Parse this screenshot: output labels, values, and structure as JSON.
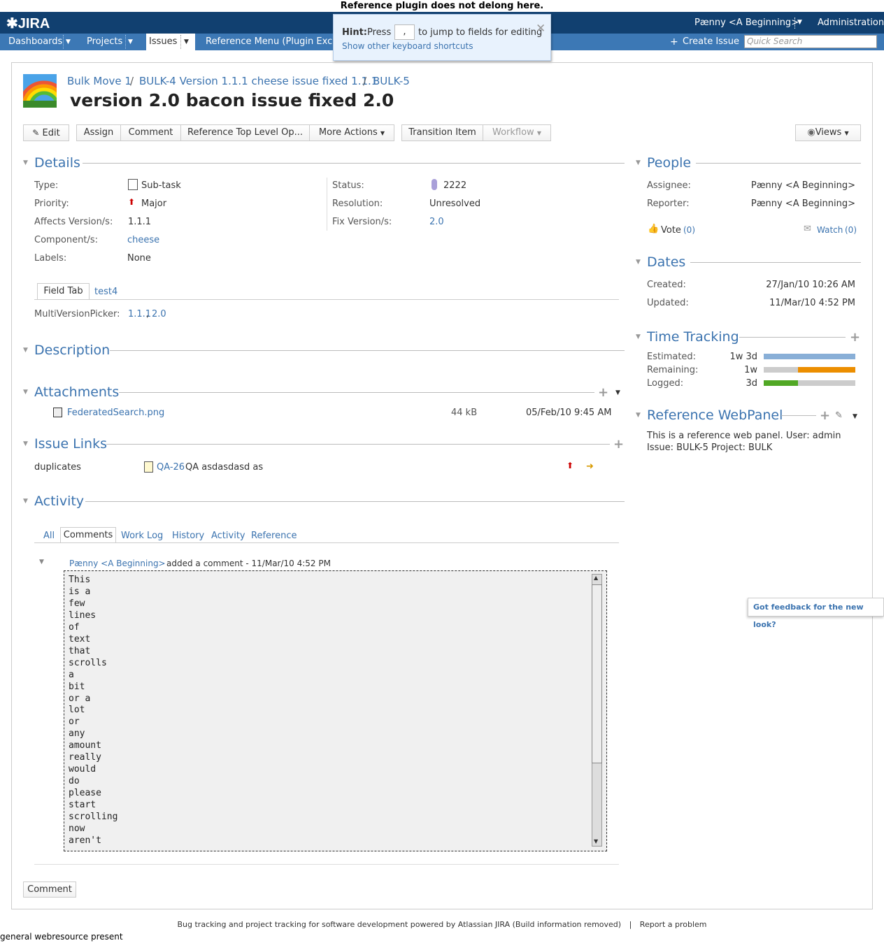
{
  "banner": "Reference plugin does not delong here.",
  "header": {
    "logo": "JIRA",
    "user": "Pænny <A Beginning>",
    "admin": "Administration"
  },
  "nav": {
    "dashboards": "Dashboards",
    "projects": "Projects",
    "issues": "Issues",
    "reference_menu": "Reference Menu (Plugin Excha",
    "create_issue": "Create Issue",
    "search_placeholder": "Quick Search"
  },
  "hint": {
    "label": "Hint:",
    "press": "Press",
    "key": ",",
    "after": "to jump to fields for editing",
    "link": "Show other keyboard shortcuts"
  },
  "breadcrumb": {
    "project": "Bulk Move 1",
    "parent": "BULK-4 Version 1.1.1 cheese issue fixed 1.1.1",
    "key": "BULK-5",
    "sep": "/"
  },
  "issue": {
    "summary": "version 2.0 bacon issue fixed 2.0"
  },
  "toolbar": {
    "edit": "Edit",
    "assign": "Assign",
    "comment": "Comment",
    "ref_op": "Reference Top Level Op...",
    "more_actions": "More Actions",
    "transition": "Transition Item",
    "workflow": "Workflow",
    "views": "Views"
  },
  "details": {
    "title": "Details",
    "type_label": "Type:",
    "type": "Sub-task",
    "priority_label": "Priority:",
    "priority": "Major",
    "affects_label": "Affects Version/s:",
    "affects": "1.1.1",
    "component_label": "Component/s:",
    "component": "cheese",
    "labels_label": "Labels:",
    "labels": "None",
    "status_label": "Status:",
    "status": "2222",
    "resolution_label": "Resolution:",
    "resolution": "Unresolved",
    "fix_label": "Fix Version/s:",
    "fix": "2.0",
    "tab_field": "Field Tab",
    "tab_test4": "test4",
    "mvp_label": "MultiVersionPicker:",
    "mvp_v1": "1.1.1",
    "mvp_comma": ",",
    "mvp_v2": "2.0"
  },
  "description": {
    "title": "Description"
  },
  "attachments": {
    "title": "Attachments",
    "file": "FederatedSearch.png",
    "size": "44 kB",
    "date": "05/Feb/10 9:45 AM"
  },
  "links": {
    "title": "Issue Links",
    "type": "duplicates",
    "key": "QA-26",
    "summary": "QA asdasdasd as"
  },
  "activity": {
    "title": "Activity",
    "tabs": [
      "All",
      "Comments",
      "Work Log",
      "History",
      "Activity",
      "Reference"
    ],
    "author": "Pænny <A Beginning>",
    "meta": "added a comment - 11/Mar/10 4:52 PM",
    "comment": "This\nis a\nfew\nlines\nof\ntext\nthat\nscrolls\na\nbit\nor a\nlot\nor\nany\namount\nreally\nwould\ndo\nplease\nstart\nscrolling\nnow\naren't",
    "comment_button": "Comment"
  },
  "people": {
    "title": "People",
    "assignee_label": "Assignee:",
    "assignee": "Pænny <A Beginning>",
    "reporter_label": "Reporter:",
    "reporter": "Pænny <A Beginning>",
    "vote": "Vote",
    "vote_count": "(0)",
    "watch": "Watch",
    "watch_count": "(0)"
  },
  "dates": {
    "title": "Dates",
    "created_label": "Created:",
    "created": "27/Jan/10 10:26 AM",
    "updated_label": "Updated:",
    "updated": "11/Mar/10 4:52 PM"
  },
  "time_tracking": {
    "title": "Time Tracking",
    "estimated_label": "Estimated:",
    "estimated": "1w 3d",
    "estimated_fraction": 1.0,
    "remaining_label": "Remaining:",
    "remaining": "1w",
    "remaining_fraction": 0.625,
    "logged_label": "Logged:",
    "logged": "3d",
    "logged_fraction": 0.375,
    "colors": {
      "estimated": "#89afd7",
      "remaining": "#ec8e00",
      "logged": "#51a825",
      "empty": "#cccccc"
    }
  },
  "web_panel": {
    "title": "Reference WebPanel",
    "text": "This is a reference web panel. User: admin Issue: BULK-5 Project: BULK"
  },
  "feedback": "Got feedback for the new look?",
  "footer": {
    "text": "Bug tracking and project tracking for software development powered by Atlassian JIRA (Build information removed)",
    "sep": "|",
    "report": "Report a problem"
  },
  "status_line": "general webresource present"
}
